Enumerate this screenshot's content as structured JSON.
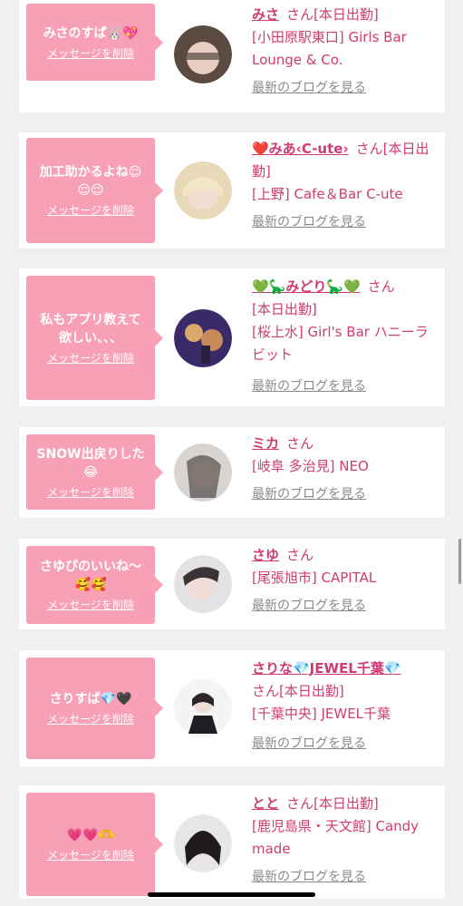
{
  "cards": [
    {
      "message": "みさのすぱ🐰💖",
      "delete_label": "メッセージを削除",
      "name": "みさ",
      "san": "さん",
      "status": "[本日出勤]",
      "location": "[小田原駅東口] Girls Bar Lounge & Co.",
      "blog_label": "最新のブログを見る"
    },
    {
      "message": "加工助かるよね😌\n😌😌",
      "delete_label": "メッセージを削除",
      "name": "❤️みあ‹C-ute›",
      "san": "さん",
      "status": "[本日出勤]",
      "location": "[上野] Cafe＆Bar C-ute",
      "blog_label": "最新のブログを見る"
    },
    {
      "message": "私もアプリ教えて\n欲しい、、、",
      "delete_label": "メッセージを削除",
      "name": "💚🦕みどり🦕💚",
      "san": "さん",
      "status": "[本日出勤]",
      "location": "[桜上水] Girl's Bar ハニーラビット",
      "blog_label": "最新のブログを見る"
    },
    {
      "message": "SNOW出戻りした\n😂",
      "delete_label": "メッセージを削除",
      "name": "ミカ",
      "san": "さん",
      "status": "",
      "location": "[岐阜 多治見] NEO",
      "blog_label": "最新のブログを見る"
    },
    {
      "message": "さゆぴのいいね〜\n🥰🥰",
      "delete_label": "メッセージを削除",
      "name": "さゆ",
      "san": "さん",
      "status": "",
      "location": "[尾張旭市] CAPITAL",
      "blog_label": "最新のブログを見る"
    },
    {
      "message": "さりすぱ💎🖤",
      "delete_label": "メッセージを削除",
      "name": "さりな💎JEWEL千葉💎",
      "san": "さん",
      "status": "[本日出勤]",
      "location": "[千葉中央] JEWEL千葉",
      "blog_label": "最新のブログを見る"
    },
    {
      "message": "💗💗🫶",
      "delete_label": "メッセージを削除",
      "name": "とと",
      "san": "さん",
      "status": "[本日出勤]",
      "location": "[鹿児島県・天文館] Candy made",
      "blog_label": "最新のブログを見る"
    }
  ],
  "colors": {
    "accent": "#d23a74",
    "bubble": "#f8a0b5",
    "card": "#ffffff",
    "background": "#f0f0f0",
    "muted": "#8a8a8a"
  }
}
